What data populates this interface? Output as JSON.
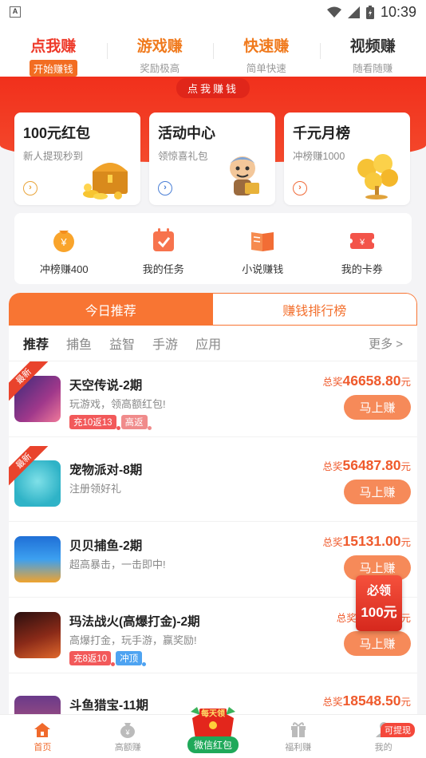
{
  "status_bar": {
    "time": "10:39",
    "notification": "A"
  },
  "top_nav": [
    {
      "title": "点我赚",
      "sub": "开始赚钱"
    },
    {
      "title": "游戏赚",
      "sub": "奖励极高"
    },
    {
      "title": "快速赚",
      "sub": "简单快速"
    },
    {
      "title": "视频赚",
      "sub": "随看随赚"
    }
  ],
  "banner_label": "点我赚钱",
  "feature_cards": [
    {
      "title": "100元红包",
      "sub": "新人提现秒到",
      "icon": "treasure-chest-icon"
    },
    {
      "title": "活动中心",
      "sub": "领惊喜礼包",
      "icon": "mascot-icon"
    },
    {
      "title": "千元月榜",
      "sub": "冲榜赚1000",
      "icon": "gold-coins-icon"
    }
  ],
  "quick_actions": [
    {
      "label": "冲榜赚400",
      "icon": "coin-bag-icon"
    },
    {
      "label": "我的任务",
      "icon": "task-calendar-icon"
    },
    {
      "label": "小说赚钱",
      "icon": "book-icon"
    },
    {
      "label": "我的卡券",
      "icon": "coupon-icon"
    }
  ],
  "segment": {
    "left": "今日推荐",
    "right": "赚钱排行榜"
  },
  "categories": [
    "推荐",
    "捕鱼",
    "益智",
    "手游",
    "应用"
  ],
  "more_label": "更多 >",
  "games": [
    {
      "name": "天空传说-2期",
      "desc": "玩游戏，领高额红包!",
      "prize_prefix": "总奖",
      "prize": "46658.80",
      "unit": "元",
      "button": "马上赚",
      "ribbon": "最新",
      "tags": [
        {
          "text": "充10返13",
          "style": "red"
        },
        {
          "text": "高返",
          "style": "pink"
        }
      ]
    },
    {
      "name": "宠物派对-8期",
      "desc": "注册领好礼",
      "prize_prefix": "总奖",
      "prize": "56487.80",
      "unit": "元",
      "button": "马上赚",
      "ribbon": "最新",
      "tags": []
    },
    {
      "name": "贝贝捕鱼-2期",
      "desc": "超高暴击，一击即中!",
      "prize_prefix": "总奖",
      "prize": "15131.00",
      "unit": "元",
      "button": "马上赚",
      "ribbon": "",
      "tags": []
    },
    {
      "name": "玛法战火(高爆打金)-2期",
      "desc": "高爆打金，玩手游，赢奖励!",
      "prize_prefix": "总奖",
      "prize": "6",
      "unit": "元",
      "button": "马上赚",
      "ribbon": "",
      "tags": [
        {
          "text": "充8返10",
          "style": "red"
        },
        {
          "text": "冲顶",
          "style": "blue"
        }
      ]
    },
    {
      "name": "斗鱼猎宝-11期",
      "desc": "",
      "prize_prefix": "总奖",
      "prize": "18548.50",
      "unit": "元",
      "button": "",
      "ribbon": "",
      "tags": []
    }
  ],
  "float_badge": {
    "line1": "必领",
    "line2": "100元"
  },
  "bottom_nav": [
    {
      "label": "首页",
      "icon": "home-icon"
    },
    {
      "label": "高额赚",
      "icon": "money-bag-icon"
    },
    {
      "label": "微信红包",
      "icon": "red-envelope-icon",
      "bag_text": "每天领"
    },
    {
      "label": "福利赚",
      "icon": "gift-icon"
    },
    {
      "label": "我的",
      "icon": "user-icon",
      "badge": "可提现"
    }
  ],
  "colors": {
    "accent": "#f26d22",
    "banner_red": "#f1301c",
    "prize": "#ef5a2c",
    "wechat_green": "#1fa95a"
  }
}
